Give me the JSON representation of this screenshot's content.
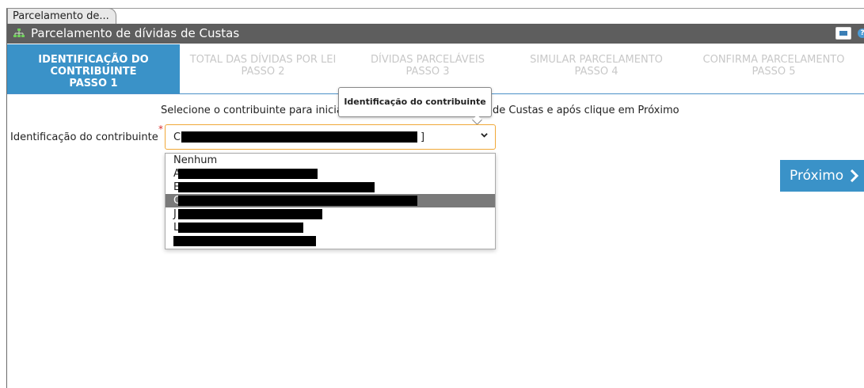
{
  "window": {
    "tab_title": "Parcelamento de...",
    "title": "Parcelamento de dívidas de Custas"
  },
  "steps": [
    {
      "label_1": "IDENTIFICAÇÃO DO",
      "label_2": "CONTRIBUINTE",
      "step": "PASSO 1",
      "active": true
    },
    {
      "label_1": "TOTAL DAS DÍVIDAS POR LEI",
      "label_2": "",
      "step": "PASSO 2",
      "active": false
    },
    {
      "label_1": "DÍVIDAS PARCELÁVEIS",
      "label_2": "",
      "step": "PASSO 3",
      "active": false
    },
    {
      "label_1": "SIMULAR PARCELAMENTO",
      "label_2": "",
      "step": "PASSO 4",
      "active": false
    },
    {
      "label_1": "CONFIRMA PARCELAMENTO",
      "label_2": "",
      "step": "PASSO 5",
      "active": false
    }
  ],
  "form": {
    "intro_start": "Selecione o contribuinte para inicia",
    "intro_end": "de Custas e após clique em Próximo",
    "tooltip": "Identificação do contribuinte",
    "field_label": "Identificação do contribuinte",
    "required_mark": "*",
    "selected_prefix": "C",
    "selected_suffix": "]",
    "options": [
      {
        "text": "Nenhum"
      },
      {
        "text": "A"
      },
      {
        "text": "E"
      },
      {
        "text": "C",
        "selected": true
      },
      {
        "text": "J"
      },
      {
        "text": "L"
      },
      {
        "text": ""
      }
    ]
  },
  "buttons": {
    "next_label": "Próximo"
  },
  "colors": {
    "accent": "#3a92c8",
    "titlebar": "#5e5e5e",
    "select_border": "#f0a838",
    "selected_option": "#7a7a7a"
  }
}
